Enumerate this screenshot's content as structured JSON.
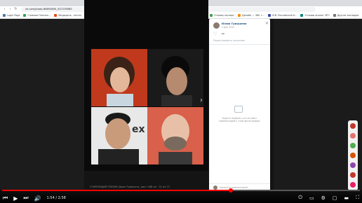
{
  "browser": {
    "url": "vk.com/photo-66893890_457239085",
    "bookmarks": [
      {
        "label": "Login Page",
        "color": "#4a76a8"
      },
      {
        "label": "Главная Платеж...",
        "color": "#2ea44f"
      },
      {
        "label": "Медицина - почты",
        "color": "#e64a19"
      },
      {
        "label": "Медицина CS/PC",
        "color": "#1e88e5"
      },
      {
        "label": "Медицина + Элек...",
        "color": "#ffb300"
      },
      {
        "label": "Ссылка Club - Ми...",
        "color": "#8e24aa"
      },
      {
        "label": "YouTube / Brandsm...",
        "color": "#e53935"
      },
      {
        "label": "Отзывы эксперт",
        "color": "#43a047"
      },
      {
        "label": "Дизайн — 360 +...",
        "color": "#fb8c00"
      },
      {
        "label": "В.В. Российский А...",
        "color": "#3949ab"
      },
      {
        "label": "Отзывы аналог ЧЕЧ",
        "color": "#00897b"
      },
      {
        "label": "Другие закладки",
        "color": "#757575"
      }
    ]
  },
  "post": {
    "author_name": "Юлия Гришаева",
    "date": "3 дек 2022",
    "edit_label": "Редактировать описание",
    "empty_comments": "Будьте первым, кто оставит комментарий к этой фотографии.",
    "comment_placeholder": "Написать комментарий...",
    "caption": "СТАРЕЮЩИЙ ТИПАЖ  Джон Траволта, рост 188 см  · 31 из 71"
  },
  "player": {
    "time": "1:54 / 2:58",
    "progress_fraction": 0.64
  },
  "colors": {
    "accent": "#ff0000",
    "link": "#2a5885"
  }
}
